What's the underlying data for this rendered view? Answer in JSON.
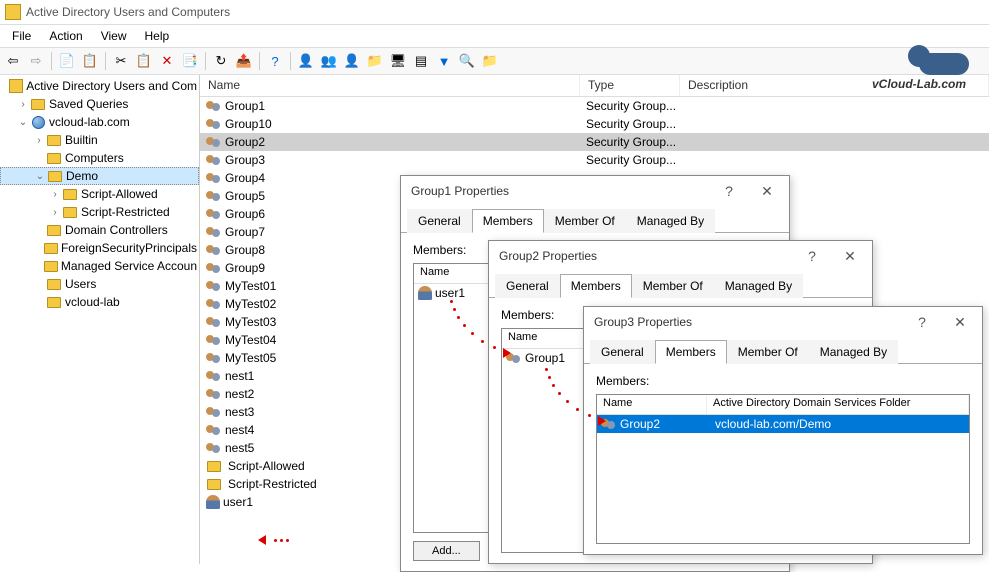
{
  "app": {
    "title": "Active Directory Users and Computers"
  },
  "menu": {
    "file": "File",
    "action": "Action",
    "view": "View",
    "help": "Help"
  },
  "logo": {
    "text": "vCloud-Lab.com"
  },
  "tree": {
    "root": "Active Directory Users and Com",
    "saved": "Saved Queries",
    "domain": "vcloud-lab.com",
    "builtin": "Builtin",
    "computers": "Computers",
    "demo": "Demo",
    "sa": "Script-Allowed",
    "sr": "Script-Restricted",
    "dc": "Domain Controllers",
    "fsp": "ForeignSecurityPrincipals",
    "msa": "Managed Service Accoun",
    "users": "Users",
    "vl": "vcloud-lab"
  },
  "list": {
    "h_name": "Name",
    "h_type": "Type",
    "h_desc": "Description",
    "type_sg": "Security Group...",
    "rows": [
      "Group1",
      "Group10",
      "Group2",
      "Group3",
      "Group4",
      "Group5",
      "Group6",
      "Group7",
      "Group8",
      "Group9",
      "MyTest01",
      "MyTest02",
      "MyTest03",
      "MyTest04",
      "MyTest05",
      "nest1",
      "nest2",
      "nest3",
      "nest4",
      "nest5"
    ],
    "sa": "Script-Allowed",
    "sr": "Script-Restricted",
    "user1": "user1"
  },
  "dlg": {
    "t_general": "General",
    "t_members": "Members",
    "t_memberof": "Member Of",
    "t_managedby": "Managed By",
    "members_lbl": "Members:",
    "name_col": "Name",
    "folder_col": "Active Directory Domain Services Folder",
    "add_btn": "Add...",
    "d1_title": "Group1 Properties",
    "d1_m1": "user1",
    "d2_title": "Group2 Properties",
    "d2_m1": "Group1",
    "d3_title": "Group3 Properties",
    "d3_m1": "Group2",
    "d3_m1_folder": "vcloud-lab.com/Demo"
  }
}
